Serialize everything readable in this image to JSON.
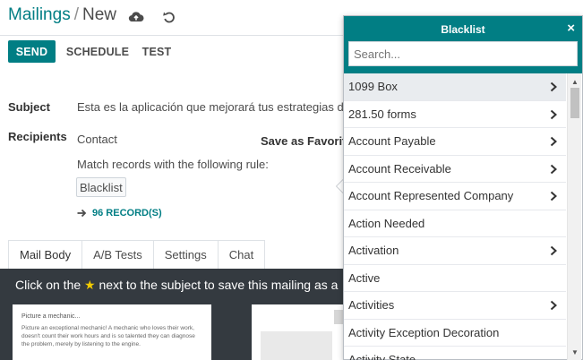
{
  "breadcrumb": {
    "parent": "Mailings",
    "separator": "/",
    "current": "New"
  },
  "header_icons": {
    "save": "cloud-upload-icon",
    "discard": "undo-icon"
  },
  "buttons": {
    "send": "SEND",
    "schedule": "SCHEDULE",
    "test": "TEST"
  },
  "form": {
    "subject_label": "Subject",
    "subject_value": "Esta es la aplicación que mejorará tus estrategias de",
    "recipients_label": "Recipients",
    "recipients_value": "Contact",
    "save_favorite": "Save as Favorite",
    "match_rule": "Match records with the following rule:",
    "rule_tag": "Blacklist",
    "records_count": "96 RECORD(S)"
  },
  "tabs": [
    {
      "label": "Mail Body",
      "active": true
    },
    {
      "label": "A/B Tests",
      "active": false
    },
    {
      "label": "Settings",
      "active": false
    },
    {
      "label": "Chat",
      "active": false
    }
  ],
  "editor": {
    "banner_before": "Click on the",
    "banner_star": "★",
    "banner_after": "next to the subject to save this mailing as a",
    "card_title": "Picture a mechanic...",
    "card_text": "Picture an exceptional mechanic! A mechanic who loves their work, doesn't count their work hours and is so talented they can diagnose the problem, merely by listening to the engine."
  },
  "popover": {
    "title": "Blacklist",
    "close": "×",
    "search_placeholder": "Search...",
    "items": [
      {
        "label": "1099 Box",
        "has_children": true
      },
      {
        "label": "281.50 forms",
        "has_children": true
      },
      {
        "label": "Account Payable",
        "has_children": true
      },
      {
        "label": "Account Receivable",
        "has_children": true
      },
      {
        "label": "Account Represented Company",
        "has_children": true
      },
      {
        "label": "Action Needed",
        "has_children": false
      },
      {
        "label": "Activation",
        "has_children": true
      },
      {
        "label": "Active",
        "has_children": false
      },
      {
        "label": "Activities",
        "has_children": true
      },
      {
        "label": "Activity Exception Decoration",
        "has_children": false
      },
      {
        "label": "Activity State",
        "has_children": false
      }
    ]
  },
  "colors": {
    "primary": "#017e84",
    "dark": "#343a40",
    "star": "#f3cc00"
  }
}
